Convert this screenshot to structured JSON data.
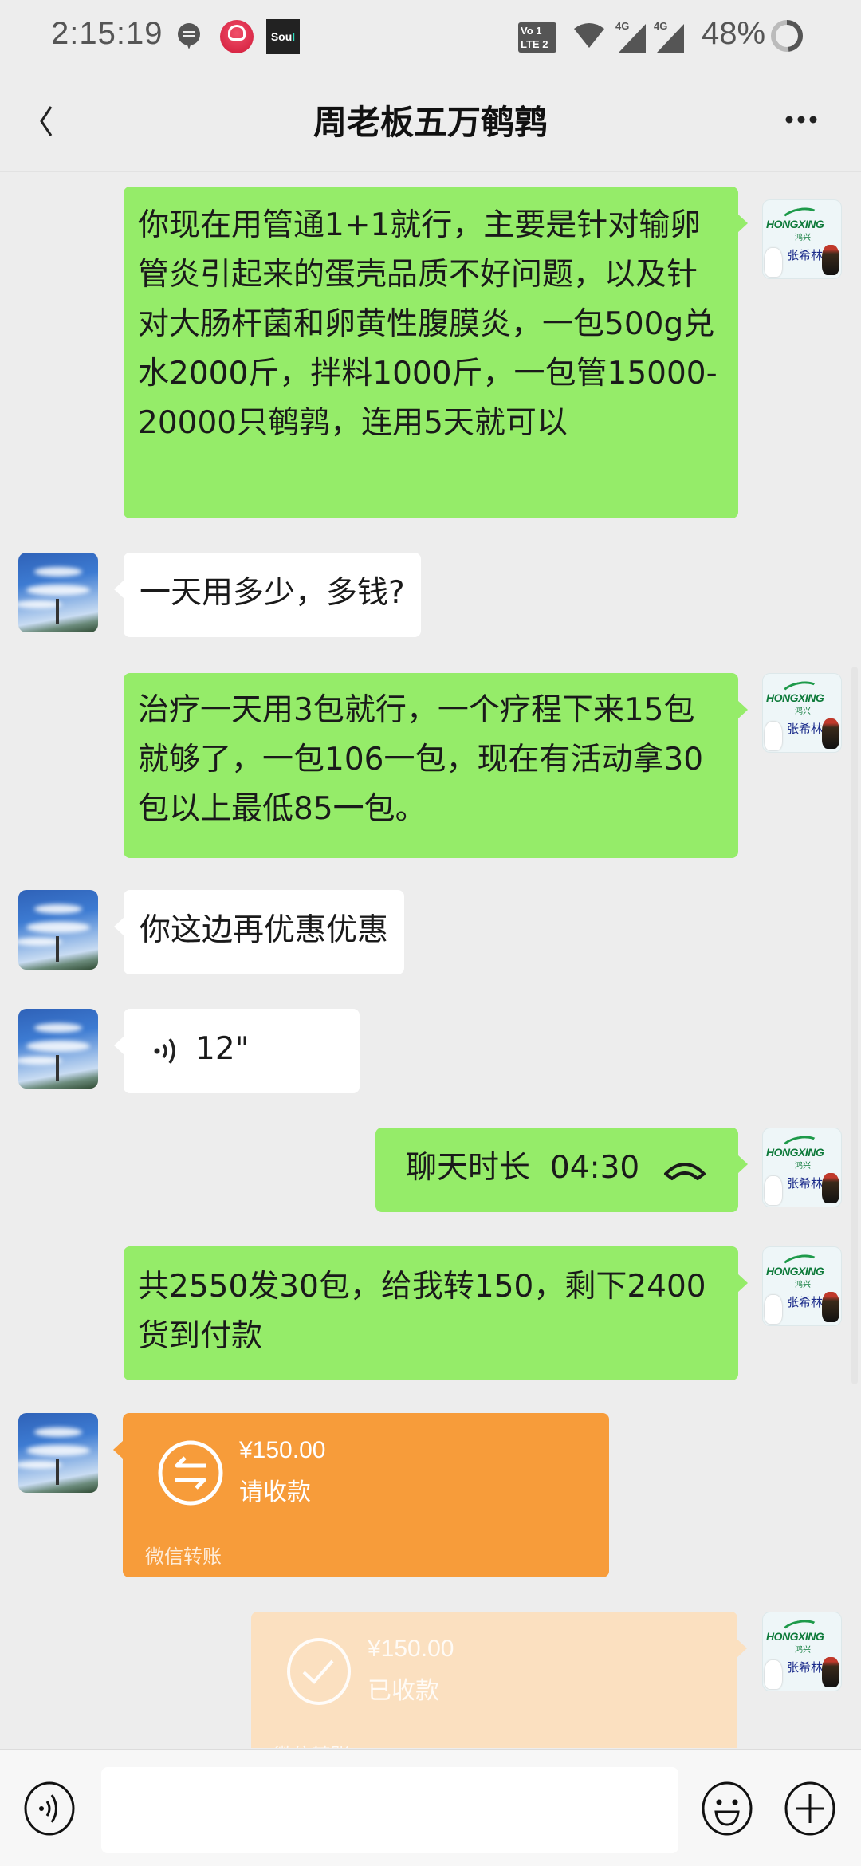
{
  "status_bar": {
    "time": "2:15:19",
    "volte_line1": "Vo 1",
    "volte_line2": "LTE 2",
    "network_1": "4G",
    "network_2": "4G",
    "battery_percent": "48%",
    "battery_level": 0.48,
    "notification_apps": [
      "message-icon",
      "kuaishou-app-icon",
      "soul-app-icon"
    ],
    "soul_label": "Sou",
    "soul_label_accent": "l"
  },
  "nav": {
    "title": "周老板五万鹌鹑",
    "back_icon": "chevron-left-icon",
    "more_icon": "more-dots-icon"
  },
  "colors": {
    "background": "#ededed",
    "bubble_self": "#95ec69",
    "bubble_other": "#ffffff",
    "transfer_pending": "#f79c3a",
    "transfer_received": "#fbe0c0"
  },
  "contacts": {
    "self_avatar": {
      "logo_text": "HONGXING",
      "logo_cn": "鸿兴",
      "name": "张希林"
    },
    "other_avatar": {
      "description": "sky-with-tower"
    }
  },
  "messages": [
    {
      "sender": "self",
      "type": "text",
      "text": "你现在用管通1+1就行，主要是针对输卵管炎引起来的蛋壳品质不好问题，以及针对大肠杆菌和卵黄性腹膜炎，一包500g兑水2000斤，拌料1000斤，一包管15000-20000只鹌鹑，连用5天就可以"
    },
    {
      "sender": "other",
      "type": "text",
      "text": "一天用多少，多钱?"
    },
    {
      "sender": "self",
      "type": "text",
      "text": "治疗一天用3包就行，一个疗程下来15包就够了，一包106一包，现在有活动拿30包以上最低85一包。"
    },
    {
      "sender": "other",
      "type": "text",
      "text": "你这边再优惠优惠"
    },
    {
      "sender": "other",
      "type": "voice",
      "duration": "12\""
    },
    {
      "sender": "self",
      "type": "call",
      "label": "聊天时长",
      "duration": "04:30"
    },
    {
      "sender": "self",
      "type": "text",
      "text": "共2550发30包，给我转150，剩下2400货到付款"
    },
    {
      "sender": "other",
      "type": "transfer",
      "amount": "¥150.00",
      "status": "请收款",
      "footer": "微信转账"
    },
    {
      "sender": "self",
      "type": "transfer_received",
      "amount": "¥150.00",
      "status": "已收款",
      "footer": "微信转账"
    }
  ],
  "input_bar": {
    "text_value": "",
    "voice_icon": "voice-input-icon",
    "emoji_icon": "emoji-icon",
    "plus_icon": "plus-icon"
  }
}
